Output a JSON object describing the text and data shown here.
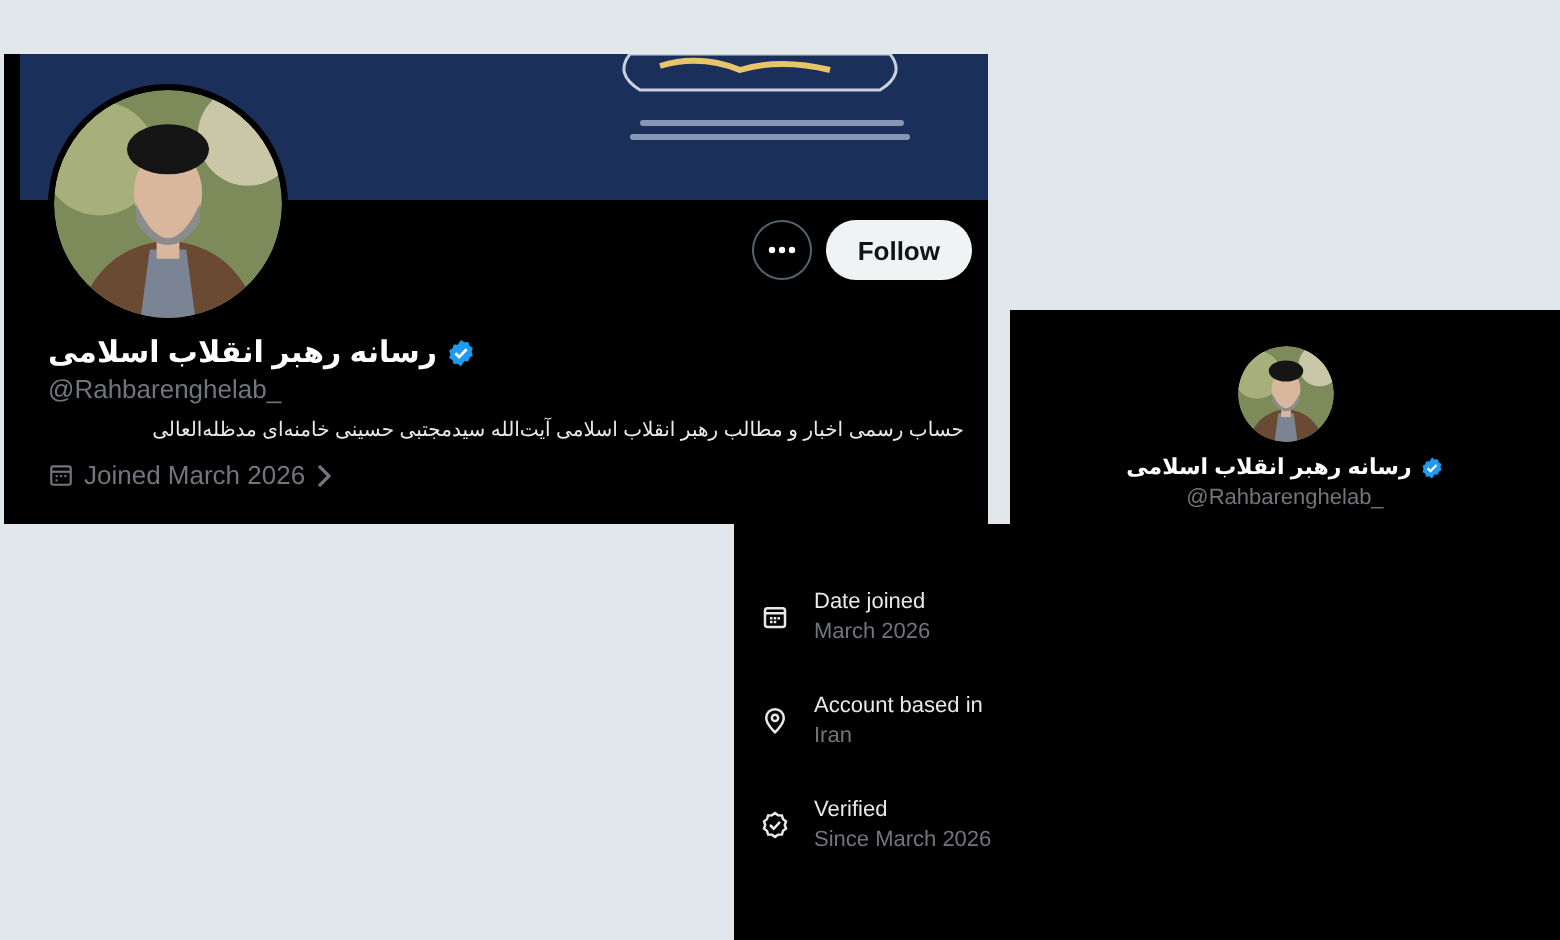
{
  "profile": {
    "display_name": "رسانه رهبر انقلاب اسلامی",
    "verified": true,
    "handle": "@Rahbarenghelab_",
    "follow_label": "Follow",
    "bio": "حساب رسمی اخبار و مطالب رهبر انقلاب اسلامی آیت‌الله سیدمجتبی حسینی خامنه‌ای مدظله‌العالی",
    "joined": "Joined March 2026"
  },
  "about_header": {
    "display_name": "رسانه رهبر انقلاب اسلامی",
    "verified": true,
    "handle": "@Rahbarenghelab_"
  },
  "about_rows": [
    {
      "kind": "calendar",
      "label": "Date joined",
      "value": "March 2026"
    },
    {
      "kind": "location",
      "label": "Account based in",
      "value": "Iran"
    },
    {
      "kind": "verified",
      "label": "Verified",
      "value": "Since March 2026"
    }
  ]
}
